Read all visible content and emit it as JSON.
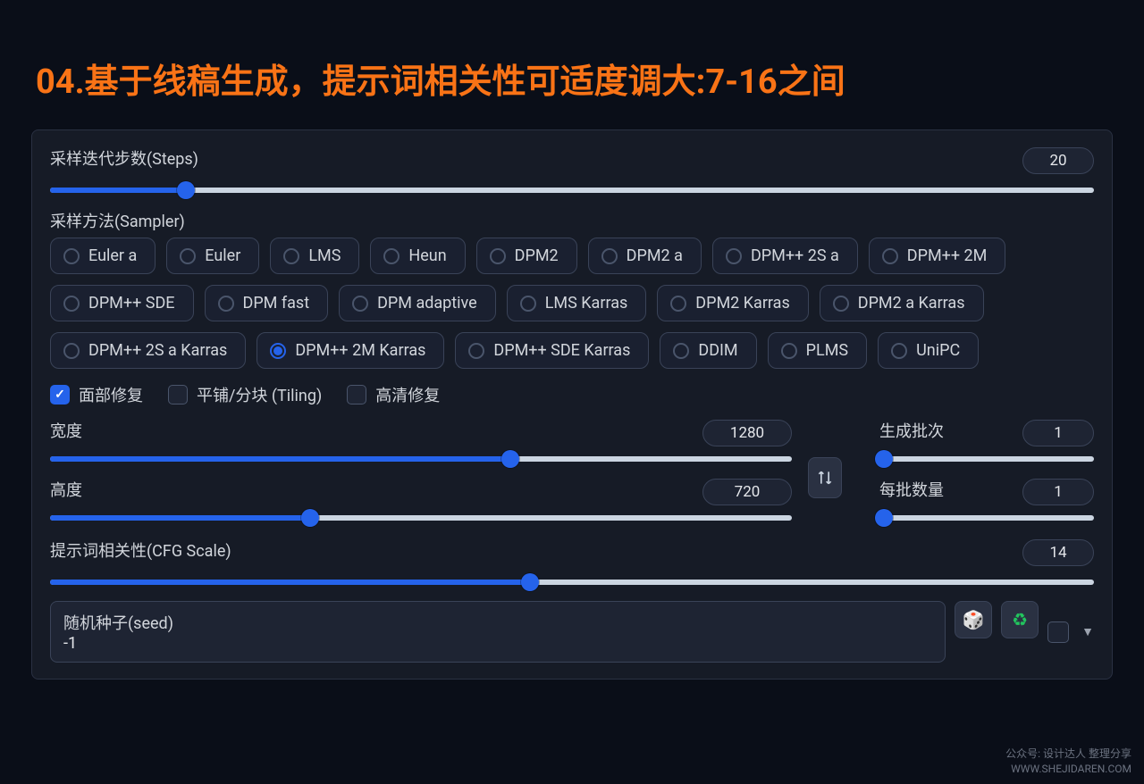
{
  "title": "04.基于线稿生成，提示词相关性可适度调大:7-16之间",
  "steps": {
    "label": "采样迭代步数(Steps)",
    "value": "20",
    "percent": 13
  },
  "sampler": {
    "label": "采样方法(Sampler)",
    "options": [
      "Euler a",
      "Euler",
      "LMS",
      "Heun",
      "DPM2",
      "DPM2 a",
      "DPM++ 2S a",
      "DPM++ 2M",
      "DPM++ SDE",
      "DPM fast",
      "DPM adaptive",
      "LMS Karras",
      "DPM2 Karras",
      "DPM2 a Karras",
      "DPM++ 2S a Karras",
      "DPM++ 2M Karras",
      "DPM++ SDE Karras",
      "DDIM",
      "PLMS",
      "UniPC"
    ],
    "selected": "DPM++ 2M Karras"
  },
  "checks": {
    "face": {
      "label": "面部修复",
      "checked": true
    },
    "tiling": {
      "label": "平铺/分块 (Tiling)",
      "checked": false
    },
    "hires": {
      "label": "高清修复",
      "checked": false
    }
  },
  "width": {
    "label": "宽度",
    "value": "1280",
    "percent": 62
  },
  "height": {
    "label": "高度",
    "value": "720",
    "percent": 35
  },
  "batch_count": {
    "label": "生成批次",
    "value": "1",
    "percent": 2
  },
  "batch_size": {
    "label": "每批数量",
    "value": "1",
    "percent": 2
  },
  "cfg": {
    "label": "提示词相关性(CFG Scale)",
    "value": "14",
    "percent": 46
  },
  "seed": {
    "label": "随机种子(seed)",
    "value": "-1"
  },
  "watermark": {
    "line1": "公众号: 设计达人 整理分享",
    "line2": "WWW.SHEJIDAREN.COM"
  }
}
